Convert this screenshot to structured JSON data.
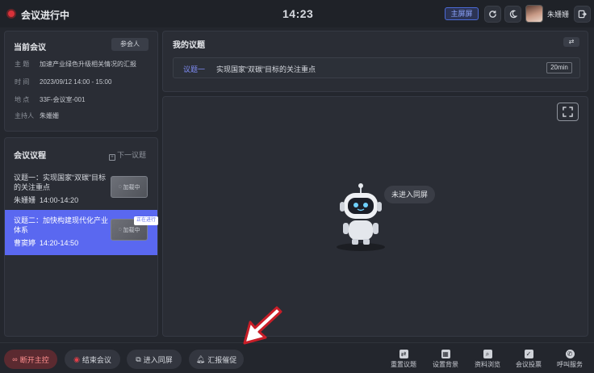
{
  "topbar": {
    "title": "会议进行中",
    "time": "14:23",
    "host_screen_label": "主屏屏",
    "user_name": "朱姗姗"
  },
  "meeting_info": {
    "title": "当前会议",
    "participants_label": "参会人",
    "topic_label": "主  题",
    "topic": "加速产业绿色升级相关情况的汇报",
    "time_label": "时  间",
    "time": "2023/09/12 14:00 - 15:00",
    "location_label": "地  点",
    "location": "33F-会议室-001",
    "host_label": "主持人",
    "host": "朱姗姗"
  },
  "agenda": {
    "title": "会议议程",
    "next_label": "下一议题",
    "items": [
      {
        "title": "议题一：实现国家“双碳”目标的关注重点",
        "presenter": "朱姗姗",
        "time": "14:00-14:20",
        "thumb": "加载中",
        "active": false
      },
      {
        "title": "议题二：加快构建现代化产业体系",
        "presenter": "曹窦婷",
        "time": "14:20-14:50",
        "thumb": "加载中",
        "active": true,
        "badge": "正在进行"
      }
    ]
  },
  "my_agenda": {
    "title": "我的议题",
    "number": "议题一",
    "text": "实现国家“双碳”目标的关注重点",
    "duration": "20min"
  },
  "screen": {
    "status": "未进入同屏"
  },
  "bottom": {
    "disconnect": "断开主控",
    "end_meeting": "结束会议",
    "enter_screen": "进入同屏",
    "report_urge": "汇报催促",
    "tools": [
      "重置议题",
      "设置背景",
      "资料浏览",
      "会议投票",
      "呼叫服务"
    ]
  },
  "colors": {
    "accent": "#5a68f0",
    "danger": "#e4404a"
  }
}
